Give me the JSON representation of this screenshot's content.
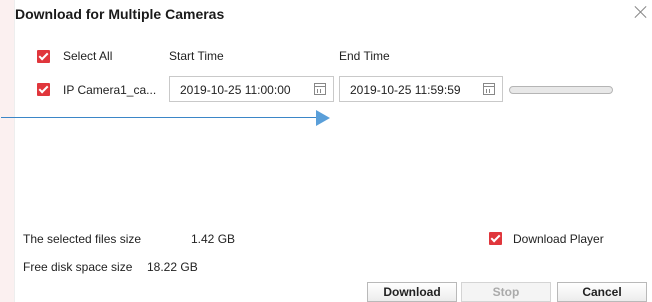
{
  "dialog": {
    "title": "Download for Multiple Cameras",
    "select_all_label": "Select All",
    "select_all_checked": true,
    "start_time_header": "Start Time",
    "end_time_header": "End Time"
  },
  "cameras": [
    {
      "name": "IP Camera1_ca...",
      "checked": true,
      "start_time": "2019-10-25 11:00:00",
      "end_time": "2019-10-25 11:59:59",
      "progress": 0
    }
  ],
  "footer": {
    "selected_size_label": "The selected files size",
    "selected_size_value": "1.42 GB",
    "free_space_label": "Free disk space size",
    "free_space_value": "18.22 GB",
    "download_player_label": "Download Player",
    "download_player_checked": true
  },
  "buttons": {
    "download": "Download",
    "stop": "Stop",
    "cancel": "Cancel"
  },
  "colors": {
    "accent": "#e0363c",
    "arrow": "#3b86c7"
  },
  "icons": [
    "close-icon",
    "calendar-icon",
    "checkbox-checked-icon"
  ]
}
